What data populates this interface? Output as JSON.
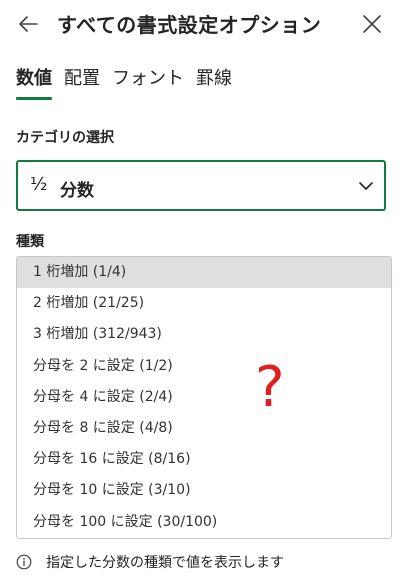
{
  "header": {
    "title": "すべての書式設定オプション"
  },
  "tabs": [
    {
      "label": "数値",
      "active": true
    },
    {
      "label": "配置",
      "active": false
    },
    {
      "label": "フォント",
      "active": false
    },
    {
      "label": "罫線",
      "active": false
    }
  ],
  "category": {
    "label": "カテゴリの選択",
    "icon_glyph": "½",
    "selected_value": "分数"
  },
  "kind": {
    "label": "種類",
    "items": [
      "1 桁増加 (1/4)",
      "2 桁増加 (21/25)",
      "3 桁増加 (312/943)",
      "分母を 2 に設定 (1/2)",
      "分母を 4 に設定 (2/4)",
      "分母を 8 に設定 (4/8)",
      "分母を 16 に設定 (8/16)",
      "分母を 10 に設定 (3/10)",
      "分母を 100 に設定 (30/100)"
    ],
    "selected_index": 0
  },
  "annotation": {
    "text": "?",
    "color": "#e02020"
  },
  "footer": {
    "info_text": "指定した分数の種類で値を表示します"
  },
  "colors": {
    "accent": "#107c41",
    "selected_bg": "#e1dfdd"
  }
}
